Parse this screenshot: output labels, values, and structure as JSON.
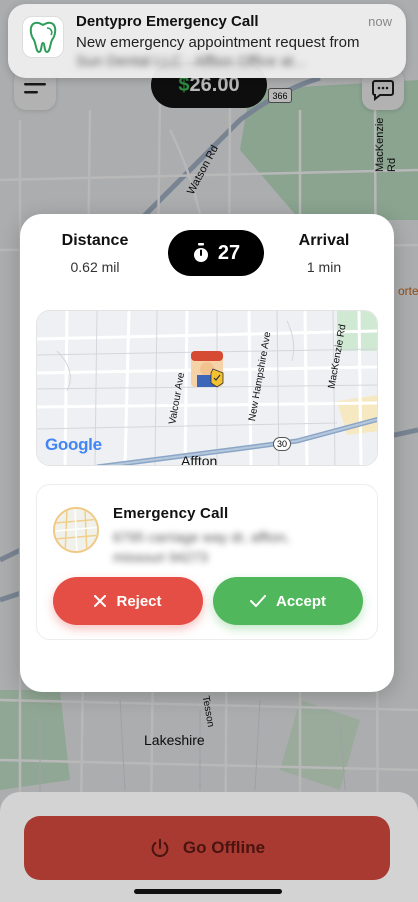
{
  "notification": {
    "title": "Dentypro Emergency Call",
    "time": "now",
    "body_prefix": "New emergency appointment request from",
    "body_blurred": "Sun Dental LLC - Affton Office at..."
  },
  "header": {
    "earnings_symbol": "$",
    "earnings_amount": "26.00"
  },
  "map_labels": {
    "highway_366": "366",
    "street_watson": "Watson Rd",
    "street_mackenzie": "MacKenzie Rd",
    "place_lakeshire": "Lakeshire",
    "fragment_orte": "orte",
    "fragment_tesson": "Tesson"
  },
  "modal": {
    "distance_label": "Distance",
    "distance_value": "0.62 mil",
    "timer_value": "27",
    "arrival_label": "Arrival",
    "arrival_value": "1 min",
    "mini_map": {
      "street_valcour": "Valcour Ave",
      "street_new_hampshire": "New Hampshire Ave",
      "street_mackenzie": "MacKenzie Rd",
      "highway_30": "30",
      "place_affton": "Affton",
      "google_logo": "Google"
    },
    "call": {
      "title": "Emergency Call",
      "address_blurred": "6795 carriage way dr, affton, missouri 94273"
    },
    "reject_label": "Reject",
    "accept_label": "Accept"
  },
  "footer": {
    "go_offline_label": "Go Offline"
  },
  "colors": {
    "reject": "#e54e44",
    "accept": "#51b75c",
    "earnings_dollar": "#3fbf5a",
    "offline": "#a83a31"
  }
}
